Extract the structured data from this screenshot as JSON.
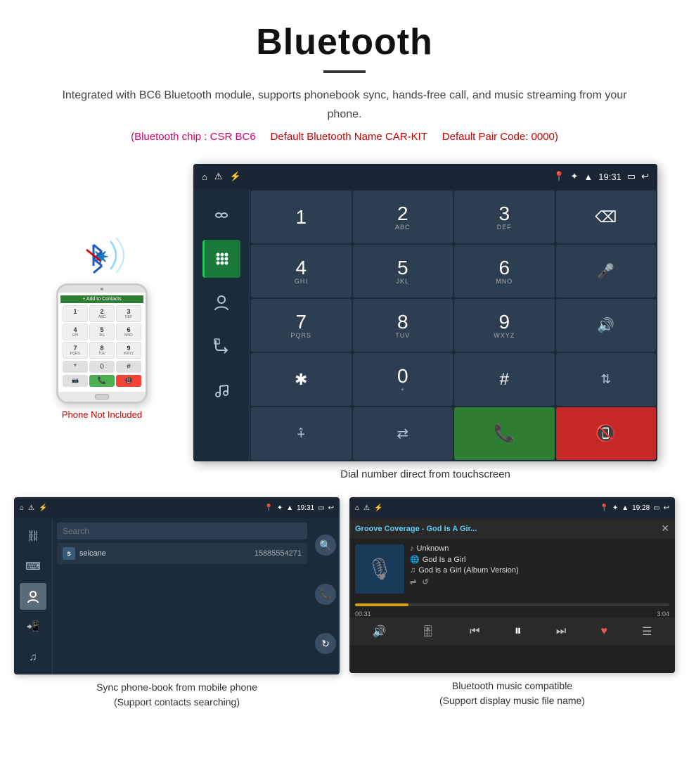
{
  "page": {
    "title": "Bluetooth",
    "description": "Integrated with BC6 Bluetooth module, supports phonebook sync, hands-free call, and music streaming from your phone.",
    "spec1": "(Bluetooth chip : CSR BC6",
    "spec2": "Default Bluetooth Name CAR-KIT",
    "spec3": "Default Pair Code: 0000)",
    "phone_not_included": "Phone Not Included",
    "dial_caption": "Dial number direct from touchscreen",
    "phonebook_caption1": "Sync phone-book from mobile phone",
    "phonebook_caption2": "(Support contacts searching)",
    "music_caption1": "Bluetooth music compatible",
    "music_caption2": "(Support display music file name)"
  },
  "status_bar": {
    "time": "19:31",
    "time2": "19:28"
  },
  "dialpad": {
    "keys": [
      {
        "num": "1",
        "sub": ""
      },
      {
        "num": "2",
        "sub": "ABC"
      },
      {
        "num": "3",
        "sub": "DEF"
      },
      {
        "num": "4",
        "sub": "GHI"
      },
      {
        "num": "5",
        "sub": "JKL"
      },
      {
        "num": "6",
        "sub": "MNO"
      },
      {
        "num": "7",
        "sub": "PQRS"
      },
      {
        "num": "8",
        "sub": "TUV"
      },
      {
        "num": "9",
        "sub": "WXYZ"
      },
      {
        "num": "＊",
        "sub": ""
      },
      {
        "num": "0",
        "sub": "+"
      },
      {
        "num": "#",
        "sub": ""
      }
    ]
  },
  "phonebook": {
    "search_placeholder": "Search",
    "contact_avatar": "s",
    "contact_name": "seicane",
    "contact_number": "15885554271"
  },
  "music": {
    "song_title": "Groove Coverage - God Is A Gir...",
    "artist": "Unknown",
    "album": "God Is a Girl",
    "track": "God is a Girl (Album Version)",
    "time_current": "00:31",
    "time_total": "3:04",
    "progress_pct": 17
  }
}
